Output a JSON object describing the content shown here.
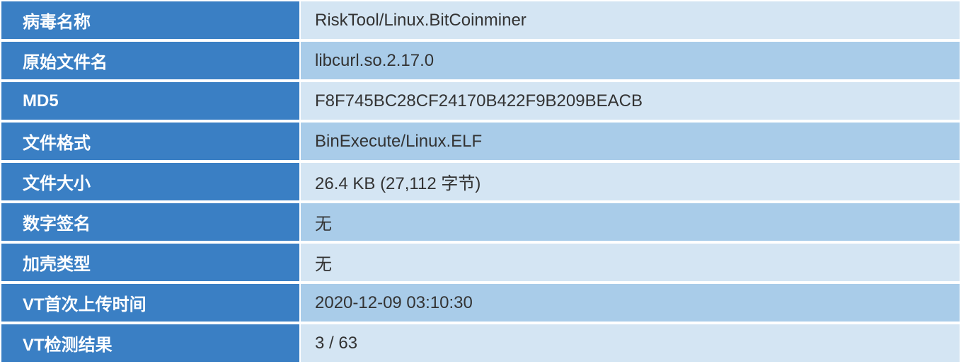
{
  "rows": [
    {
      "label": "病毒名称",
      "value": "RiskTool/Linux.BitCoinminer"
    },
    {
      "label": "原始文件名",
      "value": "libcurl.so.2.17.0"
    },
    {
      "label": "MD5",
      "value": "F8F745BC28CF24170B422F9B209BEACB"
    },
    {
      "label": "文件格式",
      "value": "BinExecute/Linux.ELF"
    },
    {
      "label": "文件大小",
      "value": "26.4 KB (27,112 字节)"
    },
    {
      "label": "数字签名",
      "value": "无"
    },
    {
      "label": "加壳类型",
      "value": "无"
    },
    {
      "label": "VT首次上传时间",
      "value": "2020-12-09 03:10:30"
    },
    {
      "label": "VT检测结果",
      "value": "3 / 63"
    }
  ]
}
